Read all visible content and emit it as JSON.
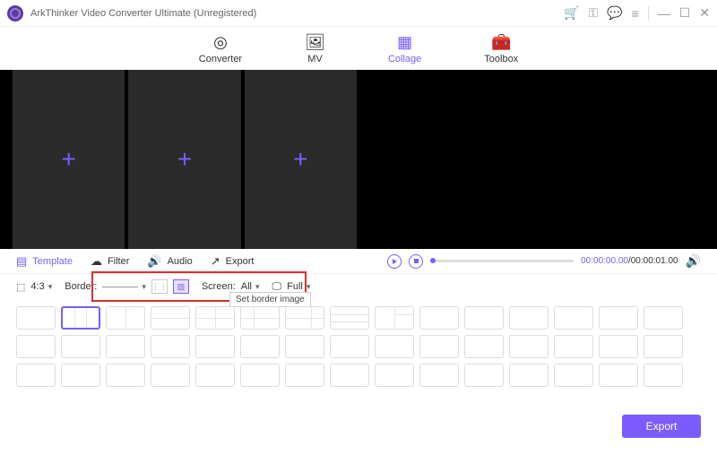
{
  "app": {
    "title": "ArkThinker Video Converter Ultimate (Unregistered)"
  },
  "nav": {
    "converter": "Converter",
    "mv": "MV",
    "collage": "Collage",
    "toolbox": "Toolbox"
  },
  "toolbar": {
    "template": "Template",
    "filter": "Filter",
    "audio": "Audio",
    "export": "Export"
  },
  "time": {
    "current": "00:00:00.00",
    "total": "00:00:01.00",
    "sep": "/"
  },
  "options": {
    "ratio": "4:3",
    "border_label": "Border:",
    "screen_label": "Screen:",
    "screen_value": "All",
    "full": "Full",
    "tooltip": "Set border image"
  },
  "export_button": "Export"
}
